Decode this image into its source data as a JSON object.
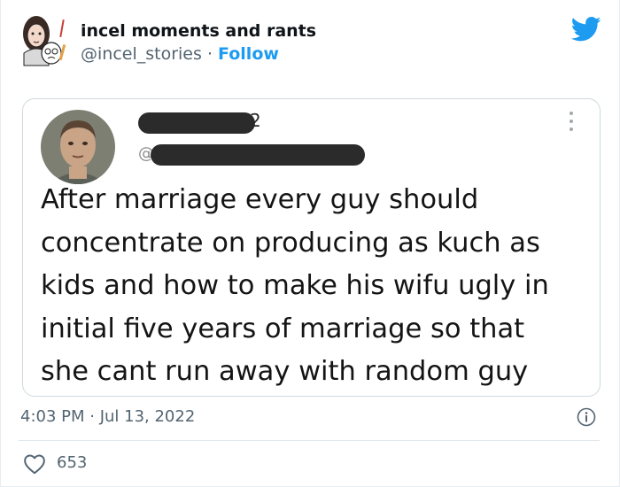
{
  "author": {
    "display_name": "incel moments and rants",
    "handle": "@incel_stories",
    "separator": "·",
    "follow_label": "Follow"
  },
  "embedded": {
    "name_tail": "2",
    "at_sign": "@",
    "text_lines": [
      "After marriage every guy should",
      "concentrate on producing as kuch as",
      "kids and how to make his  wifu ugly in",
      "initial five years of marriage  so that",
      "she cant run away with random guy"
    ]
  },
  "footer": {
    "timestamp": "4:03 PM · Jul 13, 2022",
    "likes": "653"
  },
  "colors": {
    "accent": "#1d9bf0",
    "text": "#0f1419",
    "muted": "#536471",
    "redaction": "#2b2b2b"
  },
  "icons": [
    "twitter-bird-icon",
    "more-icon",
    "info-icon",
    "heart-icon"
  ]
}
